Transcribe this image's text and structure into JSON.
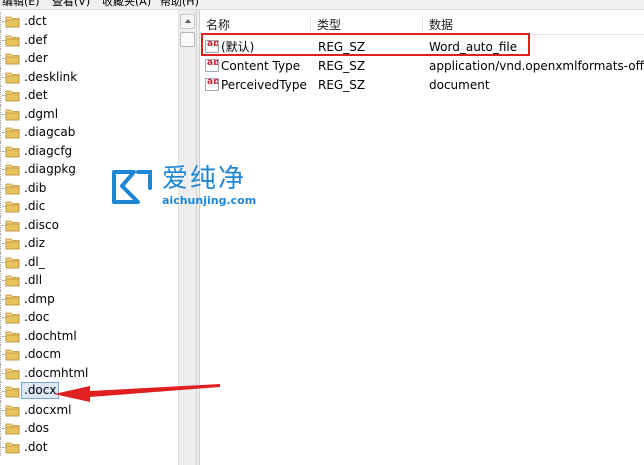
{
  "menu": {
    "items": [
      "编辑(E)",
      "查看(V)",
      "收藏夹(A)",
      "帮助(H)"
    ]
  },
  "tree": {
    "items": [
      ".dct",
      ".def",
      ".der",
      ".desklink",
      ".det",
      ".dgml",
      ".diagcab",
      ".diagcfg",
      ".diagpkg",
      ".dib",
      ".dic",
      ".disco",
      ".diz",
      ".dl_",
      ".dll",
      ".dmp",
      ".doc",
      ".dochtml",
      ".docm",
      ".docmhtml",
      ".docx",
      ".docxml",
      ".dos",
      ".dot"
    ],
    "selected": ".docx"
  },
  "values": {
    "headers": {
      "name": "名称",
      "type": "类型",
      "data": "数据"
    },
    "rows": [
      {
        "icon": "ab",
        "name": "(默认)",
        "type": "REG_SZ",
        "data": "Word_auto_file"
      },
      {
        "icon": "ab",
        "name": "Content Type",
        "type": "REG_SZ",
        "data": "application/vnd.openxmlformats-officed"
      },
      {
        "icon": "ab",
        "name": "PerceivedType",
        "type": "REG_SZ",
        "data": "document"
      }
    ]
  },
  "watermark": {
    "chinese": "爱纯净",
    "url": "aichunjing.com"
  },
  "colors": {
    "highlight": "#e02020",
    "watermark": "#1f86d6",
    "selection": "#dce8f7",
    "folder": "#e8c25a"
  }
}
